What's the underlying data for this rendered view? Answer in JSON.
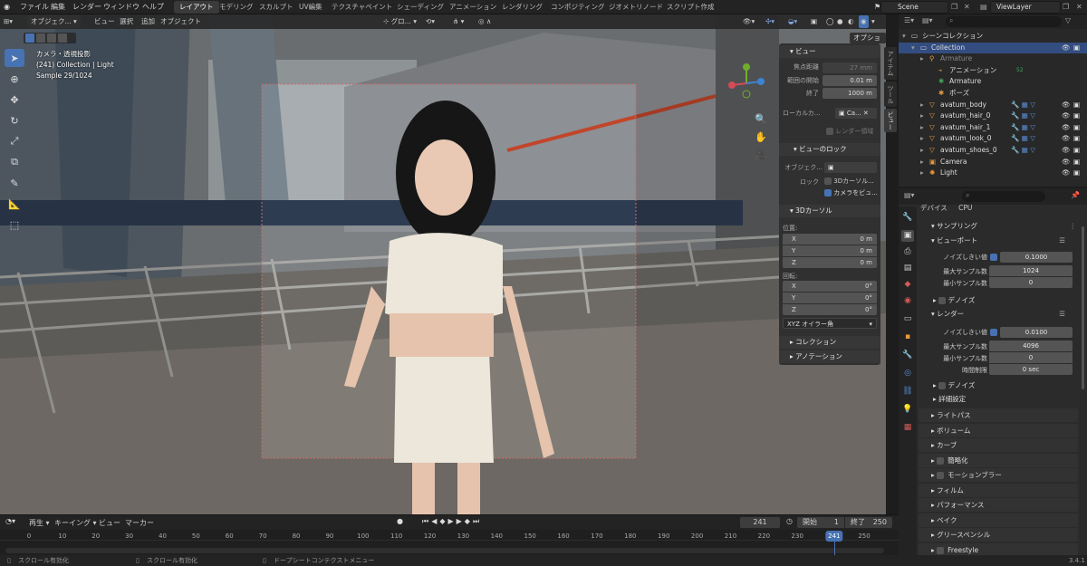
{
  "topbar": {
    "menus": [
      "ファイル",
      "編集",
      "レンダー",
      "ウィンドウ",
      "ヘルプ"
    ],
    "workspaces": [
      "レイアウト",
      "モデリング",
      "スカルプト",
      "UV編集",
      "テクスチャペイント",
      "シェーディング",
      "アニメーション",
      "レンダリング",
      "コンポジティング",
      "ジオメトリノード",
      "スクリプト作成"
    ],
    "active_workspace": "レイアウト",
    "scene": "Scene",
    "view_layer": "ViewLayer"
  },
  "viewport_header": {
    "mode": "オブジェク...",
    "menus": [
      "ビュー",
      "選択",
      "追加",
      "オブジェクト"
    ],
    "transform": "グロ...",
    "options": "オプション"
  },
  "viewport_info": {
    "line1": "カメラ・透視投影",
    "line2": "(241) Collection | Light",
    "line3": "Sample 29/1024"
  },
  "npanel": {
    "view_title": "ビュー",
    "focal_label": "焦点距離",
    "focal_value": "27 mm",
    "clip_start_label": "範囲の開始",
    "clip_start_value": "0.01 m",
    "clip_end_label": "終了",
    "clip_end_value": "1000 m",
    "local_cam_label": "ローカルカ...",
    "local_cam_value": "Ca...",
    "render_region": "レンダー領域",
    "view_lock_title": "ビューのロック",
    "lock_object_label": "オブジェク...",
    "lock_label": "ロック",
    "lock_3dcursor": "3Dカーソル...",
    "lock_camera": "カメラをビュ...",
    "cursor_title": "3Dカーソル",
    "location_label": "位置:",
    "loc_x": "0 m",
    "loc_y": "0 m",
    "loc_z": "0 m",
    "rotation_label": "回転:",
    "rot_x": "0°",
    "rot_y": "0°",
    "rot_z": "0°",
    "rotation_mode": "XYZ オイラー角",
    "collection_title": "コレクション",
    "annotation_title": "アノテーション",
    "axis_x": "X",
    "axis_y": "Y",
    "axis_z": "Z",
    "tabs": [
      "アイテム",
      "ツール",
      "ビュー"
    ]
  },
  "outliner": {
    "search_placeholder": "",
    "rows": [
      {
        "label": "シーンコレクション",
        "indent": 0,
        "icon": "scene-collection-icon"
      },
      {
        "label": "Collection",
        "indent": 1,
        "icon": "collection-icon",
        "selected": true
      },
      {
        "label": "Armature",
        "indent": 2,
        "icon": "armature-icon",
        "dim": true
      },
      {
        "label": "アニメーション",
        "indent": 3,
        "icon": "animation-icon",
        "badge": "52"
      },
      {
        "label": "Armature",
        "indent": 3,
        "icon": "armature-data-icon"
      },
      {
        "label": "ポーズ",
        "indent": 3,
        "icon": "pose-icon"
      },
      {
        "label": "avatum_body",
        "indent": 2,
        "icon": "mesh-icon"
      },
      {
        "label": "avatum_hair_0",
        "indent": 2,
        "icon": "mesh-icon"
      },
      {
        "label": "avatum_hair_1",
        "indent": 2,
        "icon": "mesh-icon"
      },
      {
        "label": "avatum_look_0",
        "indent": 2,
        "icon": "mesh-icon"
      },
      {
        "label": "avatum_shoes_0",
        "indent": 2,
        "icon": "mesh-icon"
      },
      {
        "label": "Camera",
        "indent": 2,
        "icon": "camera-icon"
      },
      {
        "label": "Light",
        "indent": 2,
        "icon": "light-icon"
      }
    ]
  },
  "properties": {
    "device_label": "デバイス",
    "device_value": "CPU",
    "sampling": "サンプリング",
    "viewport": "ビューポート",
    "noise_threshold_label": "ノイズしきい値",
    "vp_noise": "0.1000",
    "max_samples_label": "最大サンプル数",
    "vp_max": "1024",
    "min_samples_label": "最小サンプル数",
    "vp_min": "0",
    "denoise": "デノイズ",
    "render": "レンダー",
    "r_noise": "0.0100",
    "r_max": "4096",
    "r_min": "0",
    "time_limit_label": "時間制限",
    "time_limit": "0 sec",
    "advanced": "詳細設定",
    "sections": [
      "ライトパス",
      "ボリューム",
      "カーブ",
      "簡略化",
      "モーションブラー",
      "フィルム",
      "パフォーマンス",
      "ベイク",
      "グリースペンシル",
      "Freestyle"
    ]
  },
  "timeline": {
    "menus": [
      "再生",
      "キーイング",
      "ビュー",
      "マーカー"
    ],
    "current_frame": "241",
    "start_label": "開始",
    "start": "1",
    "end_label": "終了",
    "end": "250",
    "ticks": [
      "0",
      "10",
      "20",
      "30",
      "40",
      "50",
      "60",
      "70",
      "80",
      "90",
      "100",
      "110",
      "120",
      "130",
      "140",
      "150",
      "160",
      "170",
      "180",
      "190",
      "200",
      "210",
      "220",
      "230",
      "241",
      "250"
    ],
    "playhead": "241"
  },
  "statusbar": {
    "left1": "スクロール有効化",
    "left2": "スクロール有効化",
    "left3": "ドープシートコンテクストメニュー",
    "version": "3.4.1"
  },
  "colors": {
    "accent": "#4772b3",
    "selected_row": "#334d80",
    "orange_icon": "#e89a3c",
    "playhead": "#4772b3"
  }
}
